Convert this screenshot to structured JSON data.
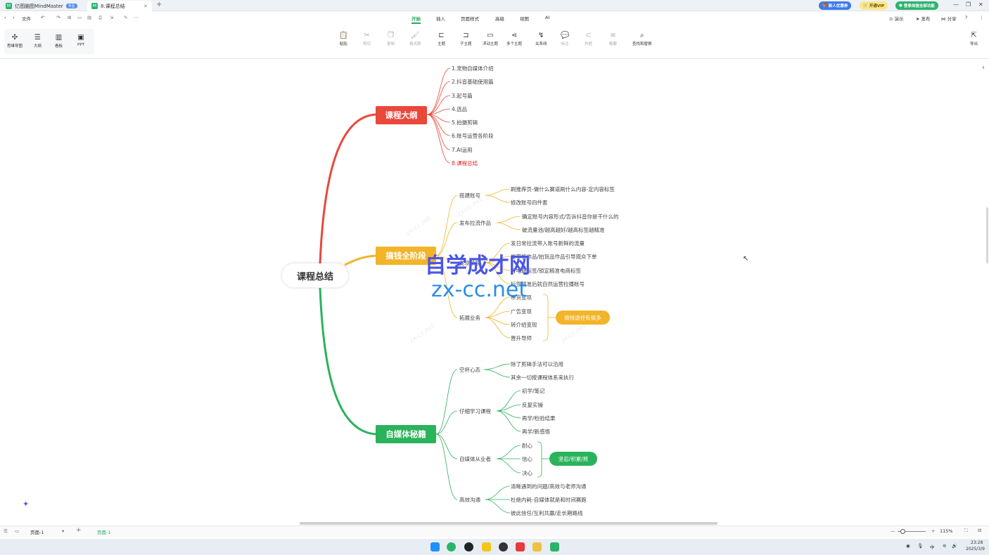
{
  "titlebar": {
    "tabs": [
      {
        "title": "亿图脑图MindMaster",
        "badge": "专业"
      },
      {
        "title": "8.课程总结"
      }
    ],
    "new_tab": "+",
    "promo": {
      "new_user": "新人优惠券",
      "vip": "开通VIP",
      "login": "登录体验全部功能"
    },
    "win": {
      "min": "—",
      "max": "❐",
      "close": "✕"
    }
  },
  "menubar": {
    "back": "‹",
    "forward": "›",
    "file": "文件",
    "items": [
      "开始",
      "插入",
      "页面样式",
      "高级",
      "视图",
      "AI"
    ],
    "active": "开始",
    "right": [
      "演示",
      "发布",
      "分享"
    ]
  },
  "toolbar": {
    "views": [
      "思维导图",
      "大纲",
      "看板",
      "PPT"
    ],
    "tools": [
      "粘贴",
      "剪切",
      "复制",
      "格式刷",
      "主题",
      "子主题",
      "浮动主题",
      "多个主题",
      "关系线",
      "标注",
      "外框",
      "概要",
      "查找和替换"
    ],
    "export": "导出"
  },
  "mindmap": {
    "root": "课程总结",
    "branches": [
      {
        "title": "课程大纲",
        "color": "#e9483b",
        "items": [
          "1.宠物自媒体介绍",
          "2.抖音基础使用篇",
          "3.起号篇",
          "4.选品",
          "5.拍摄剪辑",
          "6.账号运营各阶段",
          "7.AI运用",
          "8.课程总结"
        ],
        "highlight_color": "#e02020"
      },
      {
        "title": "搞钱全阶段",
        "color": "#f2b429",
        "groups": [
          {
            "label": "搭建账号",
            "items": [
              "刷推荐页-做什么赛道刷什么内容-定内容标签",
              "修改账号四件套"
            ]
          },
          {
            "label": "发布拉流作品",
            "items": [
              "确定账号内容形式/告诉抖音你是干什么的",
              "破流量池/越高越好/越高标签越精准"
            ]
          },
          {
            "label": "变现阶段",
            "items": [
              "发日常拉流带入账号新鲜的流量",
              "发带货作品/拍货品作品引导观众下单",
              "打电商标签/锁定精准电商标签",
              "标签精准后就自然运营拉播账号"
            ]
          },
          {
            "label": "拓展业务",
            "items": [
              "带货变现",
              "广告变现",
              "转介绍变现",
              "晋升导师"
            ],
            "summary": "搞钱途径有很多"
          }
        ]
      },
      {
        "title": "自媒体秘籍",
        "color": "#2ab35a",
        "groups": [
          {
            "label": "空杯心态",
            "items": [
              "除了剪辑手法可以沿用",
              "其余一切按课程体系来执行"
            ]
          },
          {
            "label": "仔细学习课程",
            "items": [
              "初学/笔记",
              "反复实操",
              "再学/检验结果",
              "再学/新感悟"
            ]
          },
          {
            "label": "自媒体从业者",
            "items": [
              "耐心",
              "信心",
              "决心"
            ],
            "summary": "坚忍/积累/熬"
          },
          {
            "label": "高效沟通",
            "items": [
              "清晰遇到的问题/高效与老师沟通",
              "杜绝内耗-自媒体就是和时间赛跑",
              "彼此信任/互利共赢/走长期路线"
            ]
          }
        ]
      }
    ]
  },
  "watermark": {
    "line1": "自学成才网",
    "line2": "zx-cc.net",
    "faint": "zx-cc.net",
    "color1": "#4a55e6",
    "color2": "#2a8de8"
  },
  "statusbar": {
    "page": "页面-1",
    "add": "+",
    "active_page": "页面-1",
    "zoom": "115%",
    "zoom_minus": "—",
    "zoom_plus": "+"
  },
  "taskbar": {
    "time": "23:28",
    "date": "2025/3/9",
    "lang": "中"
  }
}
